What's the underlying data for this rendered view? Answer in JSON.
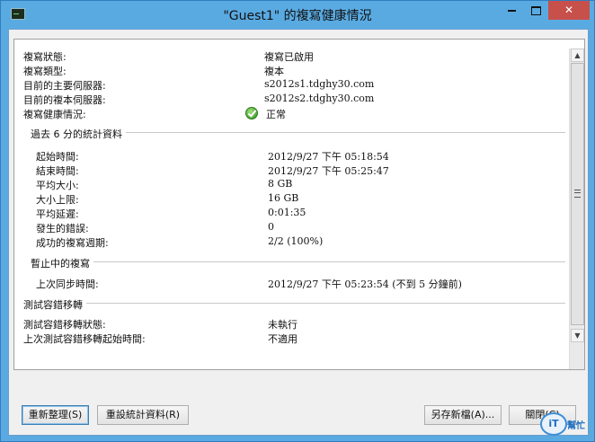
{
  "window": {
    "title": "\"Guest1\" 的複寫健康情況"
  },
  "titlebar_buttons": {
    "close": "✕"
  },
  "rows": [
    {
      "label": "複寫狀態:",
      "value": "複寫已啟用"
    },
    {
      "label": "複寫類型:",
      "value": "複本"
    },
    {
      "label": "目前的主要伺服器:",
      "value": "s2012s1.tdghy30.com"
    },
    {
      "label": "目前的複本伺服器:",
      "value": "s2012s2.tdghy30.com"
    },
    {
      "label": "複寫健康情況:",
      "value": "正常"
    }
  ],
  "stats": {
    "header": "過去 6 分的統計資料",
    "items": [
      {
        "label": "起始時間:",
        "value": "2012/9/27 下午 05:18:54"
      },
      {
        "label": "結束時間:",
        "value": "2012/9/27 下午 05:25:47"
      },
      {
        "label": "平均大小:",
        "value": "8 GB"
      },
      {
        "label": "大小上限:",
        "value": "16 GB"
      },
      {
        "label": "平均延遲:",
        "value": "0:01:35"
      },
      {
        "label": "發生的錯誤:",
        "value": "0"
      },
      {
        "label": "成功的複寫週期:",
        "value": "2/2 (100%)"
      }
    ]
  },
  "pending": {
    "header": "暫止中的複寫",
    "label": "上次同步時間:",
    "value": "2012/9/27 下午 05:23:54 (不到 5 分鐘前)"
  },
  "failover": {
    "header": "測試容錯移轉",
    "items": [
      {
        "label": "測試容錯移轉狀態:",
        "value": "未執行"
      },
      {
        "label": "上次測試容錯移轉起始時間:",
        "value": "不適用"
      }
    ]
  },
  "buttons": {
    "refresh": "重新整理(S)",
    "reset": "重設統計資料(R)",
    "save_as": "另存新檔(A)...",
    "close": "關閉(C)"
  },
  "watermark": {
    "logo": "iT",
    "text": "幫忙"
  },
  "colors": {
    "titlebar": "#5aaae2",
    "close_button": "#c7504b",
    "check": "#2f8f1f"
  }
}
